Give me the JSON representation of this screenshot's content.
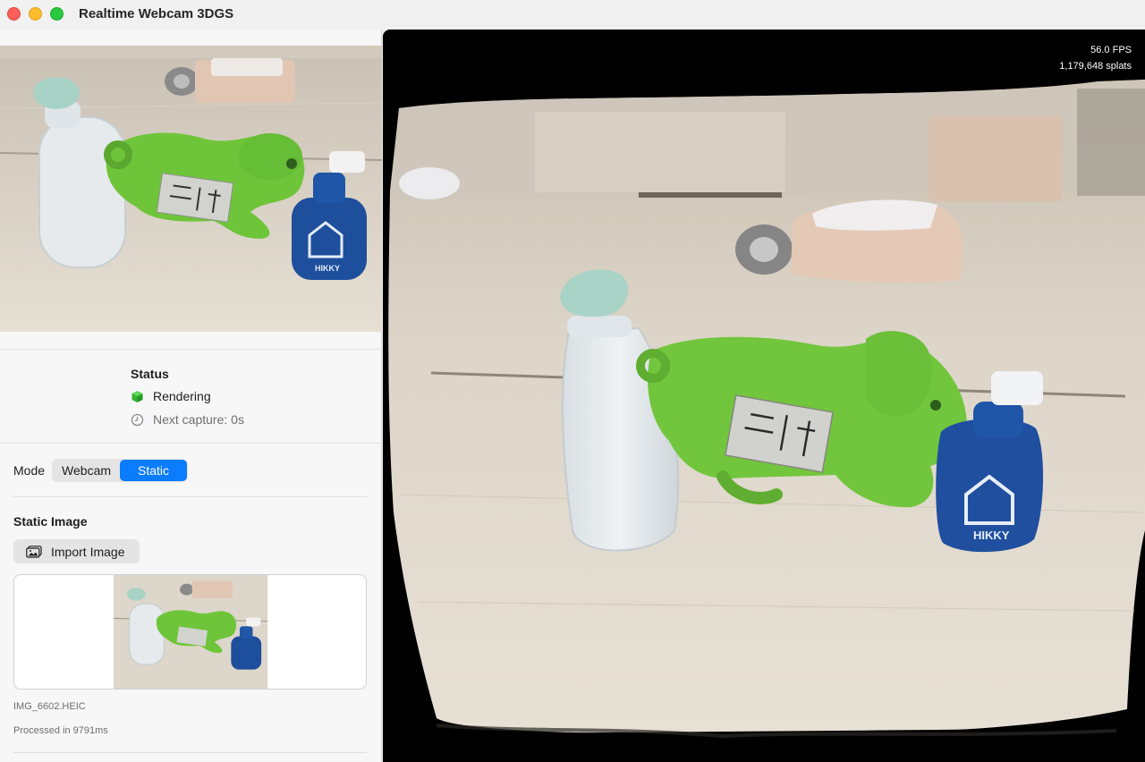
{
  "window": {
    "title": "Realtime Webcam 3DGS"
  },
  "status": {
    "title": "Status",
    "state": "Rendering",
    "next_capture": "Next capture: 0s",
    "state_icon": "green-cube-icon",
    "timer_icon": "clock-icon"
  },
  "mode": {
    "label": "Mode",
    "options": [
      "Webcam",
      "Static"
    ],
    "selected": "Static"
  },
  "static_image": {
    "title": "Static Image",
    "import_label": "Import Image",
    "import_icon": "photo-icon",
    "filename": "IMG_6602.HEIC",
    "processed": "Processed in 9791ms"
  },
  "viewport": {
    "fps": "56.0 FPS",
    "splats": "1,179,648 splats"
  },
  "colors": {
    "accent": "#0a7cff",
    "close": "#fe5f57",
    "minimize": "#febc2e",
    "maximize": "#28c840"
  }
}
